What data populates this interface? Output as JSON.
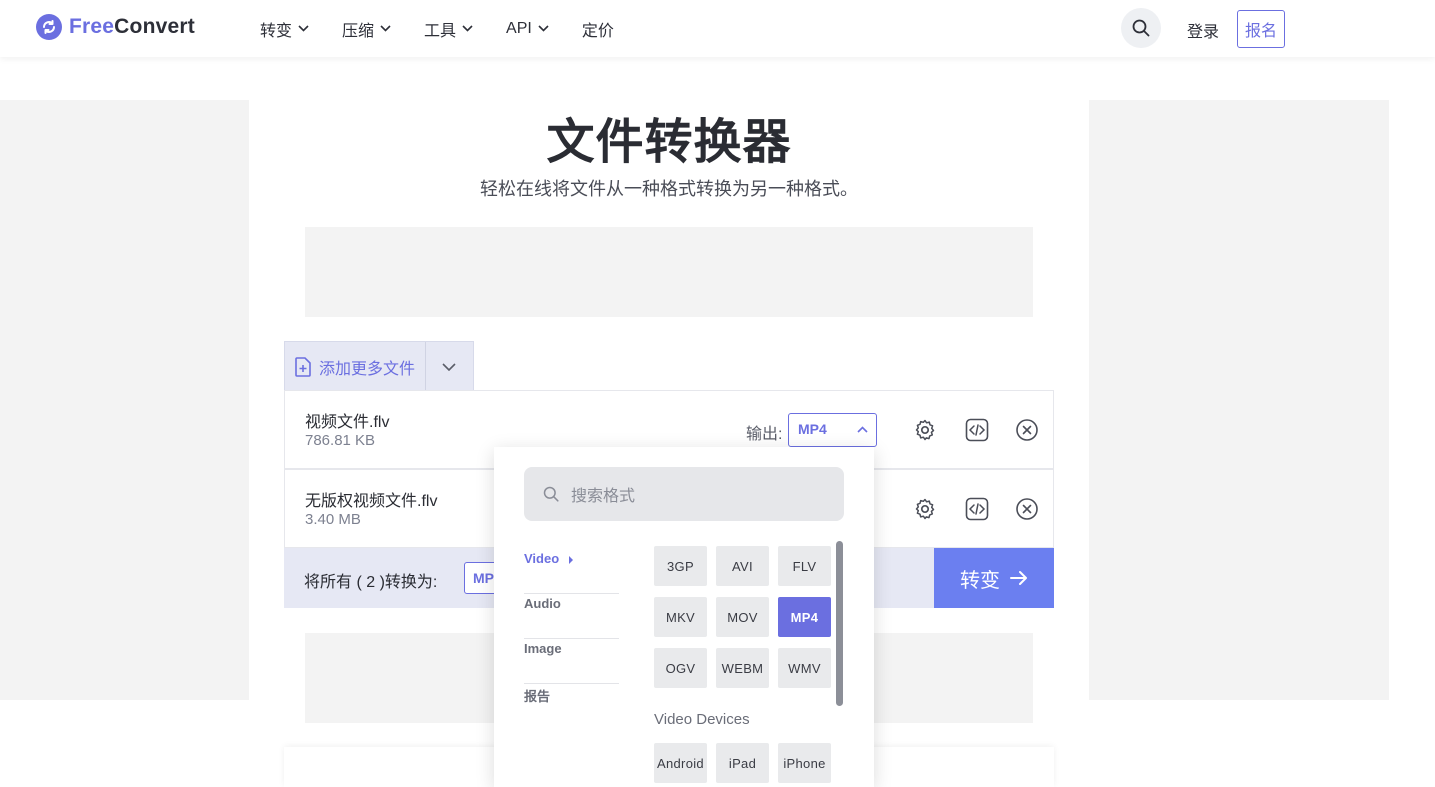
{
  "header": {
    "logo_free": "Free",
    "logo_convert": "Convert",
    "nav": [
      "转变",
      "压缩",
      "工具",
      "API",
      "定价"
    ],
    "login": "登录",
    "signup": "报名"
  },
  "hero": {
    "title": "文件转换器",
    "subtitle": "轻松在线将文件从一种格式转换为另一种格式。"
  },
  "uploader": {
    "add_files": "添加更多文件",
    "files": [
      {
        "name": "视频文件.flv",
        "size": "786.81 KB",
        "output_label": "输出:",
        "output": "MP4"
      },
      {
        "name": "无版权视频文件.flv",
        "size": "3.40 MB"
      }
    ],
    "convert_all_label": "将所有 ( 2 )转换为:",
    "convert_all_value": "MP4",
    "convert_button": "转变"
  },
  "dropdown": {
    "search_placeholder": "搜索格式",
    "categories": [
      "Video",
      "Audio",
      "Image",
      "报告"
    ],
    "active_category": "Video",
    "formats": [
      "3GP",
      "AVI",
      "FLV",
      "MKV",
      "MOV",
      "MP4",
      "OGV",
      "WEBM",
      "WMV"
    ],
    "selected_format": "MP4",
    "devices_label": "Video Devices",
    "devices": [
      "Android",
      "iPad",
      "iPhone"
    ]
  },
  "colors": {
    "accent": "#6b6fe0",
    "convert_button": "#6b7ff0",
    "toolbar_bg": "#e6e8f4"
  }
}
